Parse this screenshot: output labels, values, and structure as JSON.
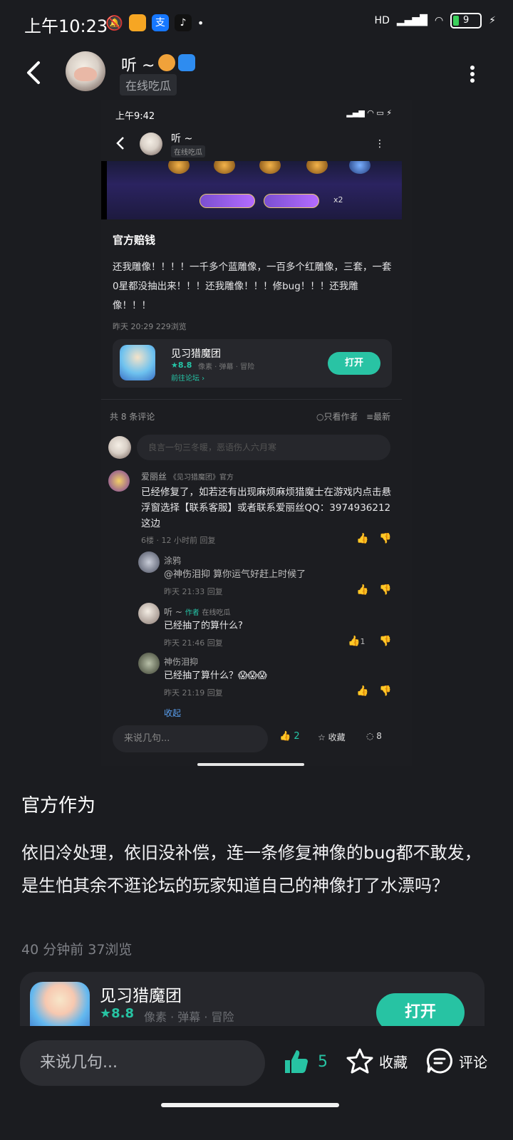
{
  "status_bar": {
    "time": "上午10:23",
    "battery": "9",
    "network": "HD"
  },
  "header": {
    "user_name": "听 ~",
    "subtitle": "在线吃瓜"
  },
  "embedded_screenshot": {
    "status_time": "上午9:42",
    "user_name": "听 ~",
    "subtitle": "在线吃瓜",
    "image_multiplier": "x2",
    "post_title": "官方赔钱",
    "post_body": "还我雕像！！！！一千多个蓝雕像，一百多个红雕像，三套，一套0星都没抽出来！！！还我雕像！！！修bug！！！还我雕像！！！",
    "post_meta": "昨天 20:29  229浏览",
    "game_card": {
      "name": "见习猎魔团",
      "rating": "★8.8",
      "tags": "像素 · 弹幕 · 冒险",
      "forum_link": "前往论坛 ›",
      "open_label": "打开"
    },
    "comments_count": "共 8 条评论",
    "filter_only_author": "○只看作者",
    "filter_latest": "≡最新",
    "comment_placeholder": "良言一句三冬暖，恶语伤人六月寒",
    "comments": [
      {
        "author": "爱丽丝",
        "tag": "《见习猎魔团》官方",
        "text": "已经修复了，如若还有出现麻烦麻烦猎魔士在游戏内点击悬浮窗选择【联系客服】或者联系爱丽丝QQ：3974936212这边",
        "meta": "6楼 · 12 小时前  回复"
      },
      {
        "author": "涂鸦",
        "text": "@神伤泪抑  算你运气好赶上时候了",
        "meta": "昨天 21:33  回复"
      },
      {
        "author": "听 ~",
        "tag_author": "作者",
        "tag_status": "在线吃瓜",
        "text": "已经抽了的算什么?",
        "meta": "昨天 21:46  回复",
        "likes": "1"
      },
      {
        "author": "神伤泪抑",
        "text": "已经抽了算什么？😱😱😱",
        "meta": "昨天 21:19  回复"
      }
    ],
    "fold_label": "收起",
    "input_placeholder": "来说几句...",
    "like_count": "2",
    "fav_label": "收藏",
    "comment_count": "8"
  },
  "post": {
    "title": "官方作为",
    "body": "依旧冷处理，依旧没补偿，连一条修复神像的bug都不敢发，是生怕其余不逛论坛的玩家知道自己的神像打了水漂吗？",
    "meta": "40 分钟前   37浏览"
  },
  "game_card": {
    "name": "见习猎魔团",
    "rating": "★8.8",
    "tags": "像素 · 弹幕 · 冒险",
    "open_label": "打开"
  },
  "bottom_bar": {
    "input_placeholder": "来说几句...",
    "like_count": "5",
    "fav_label": "收藏",
    "comment_label": "评论"
  },
  "colors": {
    "accent": "#27c3a3",
    "background": "#1b1c20",
    "card": "#26272c"
  }
}
